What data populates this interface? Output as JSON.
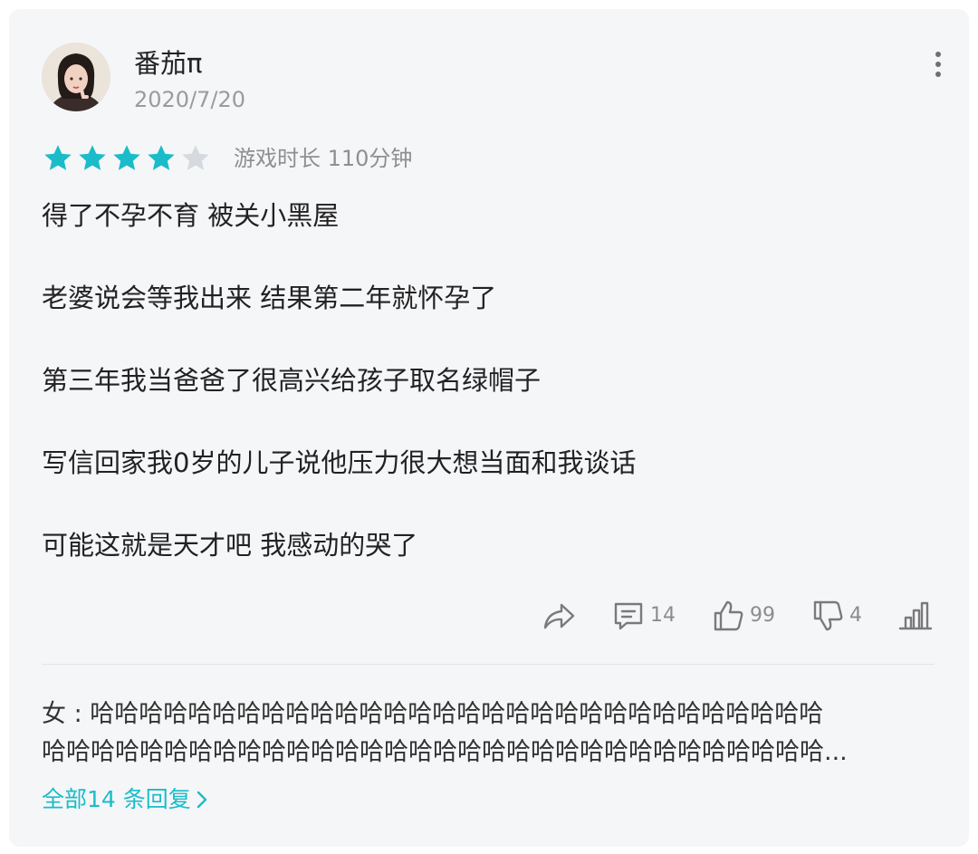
{
  "review": {
    "username": "番茄π",
    "date": "2020/7/20",
    "rating": 4,
    "rating_max": 5,
    "playtime": "游戏时长 110分钟",
    "paragraphs": [
      "得了不孕不育 被关小黑屋",
      "老婆说会等我出来 结果第二年就怀孕了",
      "第三年我当爸爸了很高兴给孩子取名绿帽子",
      "写信回家我0岁的儿子说他压力很大想当面和我谈话",
      "可能这就是天才吧 我感动的哭了"
    ]
  },
  "actions": {
    "comment_count": "14",
    "like_count": "99",
    "dislike_count": "4"
  },
  "reply": {
    "line1": "女 : 哈哈哈哈哈哈哈哈哈哈哈哈哈哈哈哈哈哈哈哈哈哈哈哈哈哈哈哈哈哈",
    "line2": "哈哈哈哈哈哈哈哈哈哈哈哈哈哈哈哈哈哈哈哈哈哈哈哈哈哈哈哈哈哈哈哈...",
    "all_replies_label": "全部14 条回复"
  },
  "colors": {
    "accent": "#1bbcc9",
    "star_on": "#1bbcc9",
    "star_off": "#d6d9dd",
    "card_bg": "#f5f6f8"
  },
  "icons": [
    "avatar",
    "more-vertical-icon",
    "star-icon",
    "share-icon",
    "comment-icon",
    "thumbs-up-icon",
    "thumbs-down-icon",
    "stats-icon",
    "chevron-right-icon"
  ]
}
